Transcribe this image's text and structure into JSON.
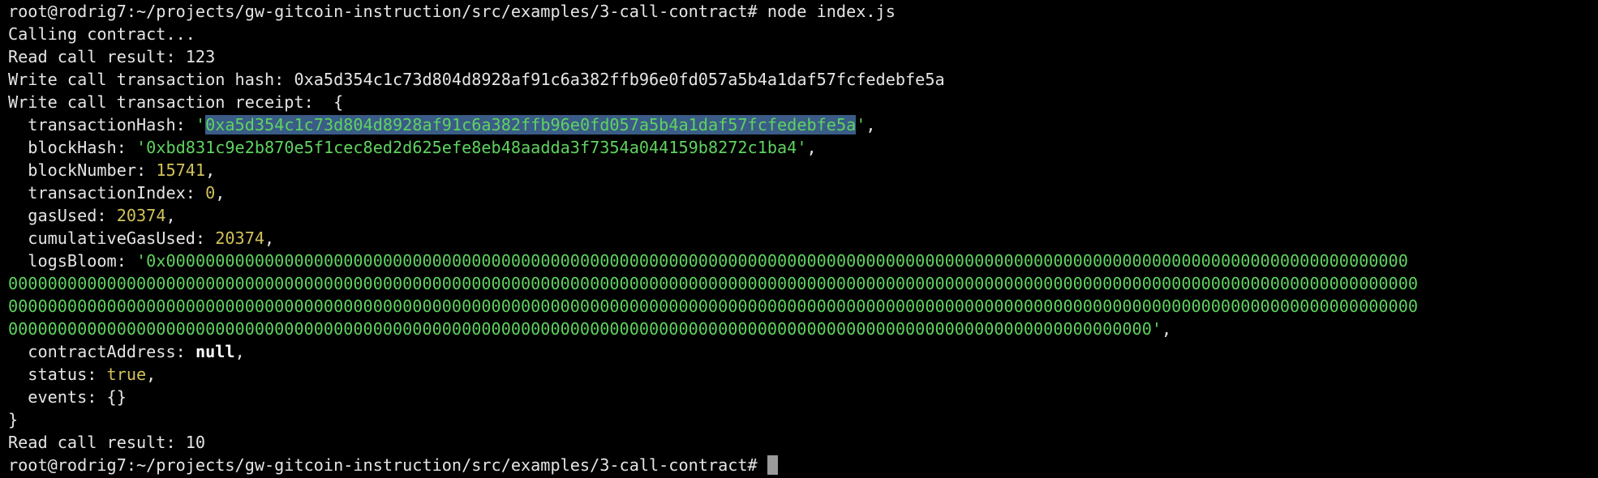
{
  "terminal": {
    "prompt_1": "root@rodrig7:~/projects/gw-gitcoin-instruction/src/examples/3-call-contract# node index.js",
    "calling": "Calling contract...",
    "read_result_1": "Read call result: 123",
    "write_hash_label": "Write call transaction hash: ",
    "write_hash_value": "0xa5d354c1c73d804d8928af91c6a382ffb96e0fd057a5b4a1daf57fcfedebfe5a",
    "receipt_label": "Write call transaction receipt:  {",
    "receipt": {
      "transactionHash_key": "  transactionHash: ",
      "transactionHash_value": "0xa5d354c1c73d804d8928af91c6a382ffb96e0fd057a5b4a1daf57fcfedebfe5a",
      "blockHash_key": "  blockHash: ",
      "blockHash_value": "'0xbd831c9e2b870e5f1cec8ed2d625efe8eb48aadda3f7354a044159b8272c1ba4'",
      "blockNumber_key": "  blockNumber: ",
      "blockNumber_value": "15741",
      "transactionIndex_key": "  transactionIndex: ",
      "transactionIndex_value": "0",
      "gasUsed_key": "  gasUsed: ",
      "gasUsed_value": "20374",
      "cumulativeGasUsed_key": "  cumulativeGasUsed: ",
      "cumulativeGasUsed_value": "20374",
      "logsBloom_key": "  logsBloom: ",
      "logsBloom_line1": "'0x000000000000000000000000000000000000000000000000000000000000000000000000000000000000000000000000000000000000000000000000000000",
      "logsBloom_line2": "00000000000000000000000000000000000000000000000000000000000000000000000000000000000000000000000000000000000000000000000000000000000000000000000",
      "logsBloom_line3": "00000000000000000000000000000000000000000000000000000000000000000000000000000000000000000000000000000000000000000000000000000000000000000000000",
      "logsBloom_line4": "00000000000000000000000000000000000000000000000000000000000000000000000000000000000000000000000000000000000000000000'",
      "contractAddress_key": "  contractAddress: ",
      "contractAddress_value": "null",
      "status_key": "  status: ",
      "status_value": "true",
      "events_line": "  events: {}"
    },
    "closing_brace": "}",
    "read_result_2": "Read call result: 10",
    "prompt_2": "root@rodrig7:~/projects/gw-gitcoin-instruction/src/examples/3-call-contract# "
  },
  "colors": {
    "background": "#000000",
    "text": "#e5e5e5",
    "string": "#5fd35f",
    "number": "#d2c25a",
    "selection": "#3a5c87"
  }
}
